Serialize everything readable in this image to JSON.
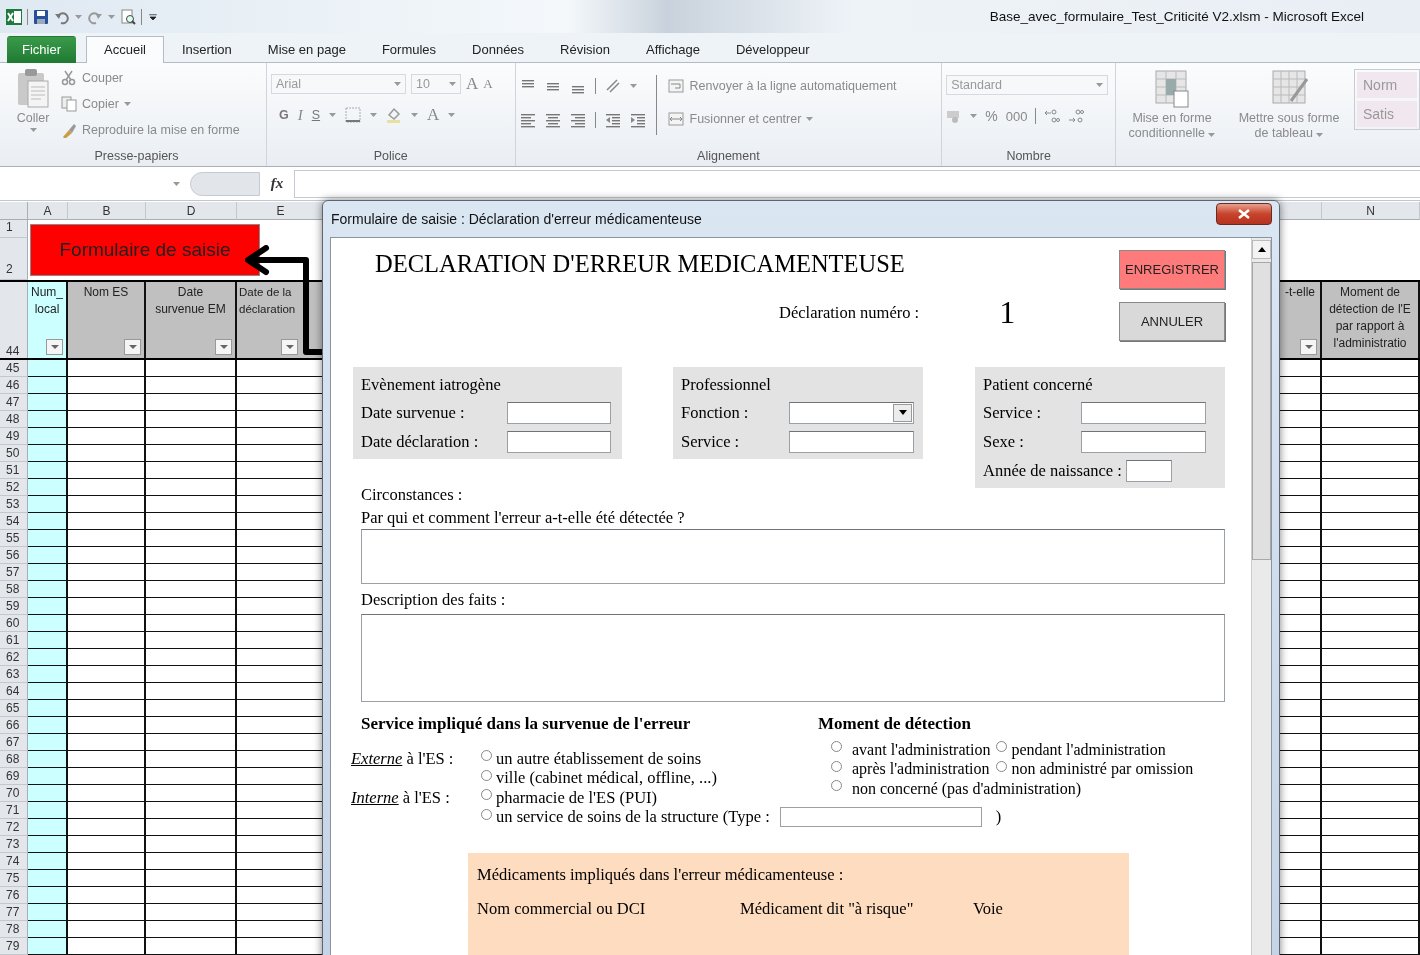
{
  "window": {
    "title": "Base_avec_formulaire_Test_Criticité V2.xlsm  -  Microsoft Excel"
  },
  "tabs": [
    {
      "label": "Fichier",
      "kind": "file",
      "selected": false
    },
    {
      "label": "Accueil",
      "kind": "tab",
      "selected": true
    },
    {
      "label": "Insertion",
      "kind": "tab",
      "selected": false
    },
    {
      "label": "Mise en page",
      "kind": "tab",
      "selected": false
    },
    {
      "label": "Formules",
      "kind": "tab",
      "selected": false
    },
    {
      "label": "Données",
      "kind": "tab",
      "selected": false
    },
    {
      "label": "Révision",
      "kind": "tab",
      "selected": false
    },
    {
      "label": "Affichage",
      "kind": "tab",
      "selected": false
    },
    {
      "label": "Développeur",
      "kind": "tab",
      "selected": false
    }
  ],
  "clipboard": {
    "paste": "Coller",
    "cut": "Couper",
    "copy": "Copier",
    "format_painter": "Reproduire la mise en forme",
    "group": "Presse-papiers"
  },
  "font": {
    "name": "Arial",
    "size": "10",
    "grow": "A",
    "shrink": "A",
    "bold": "G",
    "italic": "I",
    "underline": "S",
    "font_color": "A",
    "group": "Police"
  },
  "alignment": {
    "wrap": "Renvoyer à la ligne automatiquement",
    "merge": "Fusionner et centrer",
    "group": "Alignement"
  },
  "number": {
    "format": "Standard",
    "percent": "%",
    "thousands": "000",
    "group": "Nombre"
  },
  "styles": {
    "conditional": "Mise en forme conditionnelle",
    "table": "Mettre sous forme de tableau",
    "cell_styles": [
      "Norm",
      "Satis"
    ]
  },
  "formula_bar": {
    "function_label": "fx"
  },
  "sheet": {
    "columns": [
      {
        "letter": "A",
        "header": "Num_\nlocal",
        "color": "#ccffff",
        "highlighted": true,
        "filter": true
      },
      {
        "letter": "B",
        "header": "Nom ES",
        "color": "#c0c0c0",
        "highlighted": false,
        "filter": true
      },
      {
        "letter": "D",
        "header": "Date\nsurvenue EM",
        "color": "#c0c0c0",
        "highlighted": false,
        "filter": true
      },
      {
        "letter": "E",
        "header": "Date de la\ndéclaration",
        "color": "#c0c0c0",
        "highlighted": false,
        "filter": true
      },
      {
        "header": "-t-elle",
        "color": "#c0c0c0",
        "highlighted": false,
        "filter": true
      },
      {
        "letter": "N",
        "header": "Moment de\ndétection de l'E\npar rapport à\nl'administratio",
        "color": "#c0c0c0",
        "highlighted": false,
        "filter": false
      }
    ],
    "title_rows": [
      "1",
      "2"
    ],
    "header_row": "44",
    "rows": [
      "45",
      "46",
      "47",
      "48",
      "49",
      "50",
      "51",
      "52",
      "53",
      "54",
      "55",
      "56",
      "57",
      "58",
      "59",
      "60",
      "61",
      "62",
      "63",
      "64",
      "65",
      "66",
      "67",
      "68",
      "69",
      "70",
      "71",
      "72",
      "73",
      "74",
      "75",
      "76",
      "77",
      "78",
      "79"
    ],
    "form_button": "Formulaire de saisie"
  },
  "dialog": {
    "title": "Formulaire de saisie : Déclaration d'erreur médicamenteuse",
    "heading": "DECLARATION D'ERREUR MEDICAMENTEUSE",
    "buttons": [
      {
        "label": "ENREGISTRER",
        "kind": "primary"
      },
      {
        "label": "ANNULER",
        "kind": "secondary"
      }
    ],
    "number_label": "Déclaration numéro :",
    "number": "1",
    "panels": [
      {
        "title": "Evènement iatrogène",
        "fields": [
          {
            "label": "Date survenue :",
            "kind": "text"
          },
          {
            "label": "Date déclaration :",
            "kind": "text"
          }
        ]
      },
      {
        "title": "Professionnel",
        "fields": [
          {
            "label": "Fonction :",
            "kind": "dropdown"
          },
          {
            "label": "Service :",
            "kind": "text"
          }
        ]
      },
      {
        "title": "Patient concerné",
        "fields": [
          {
            "label": "Service :",
            "kind": "text"
          },
          {
            "label": "Sexe :",
            "kind": "text"
          },
          {
            "label": "Année de naissance :",
            "kind": "short"
          }
        ]
      }
    ],
    "circumstances_label": "Circonstances :",
    "question": "Par qui et comment l'erreur a-t-elle été détectée ?",
    "description_label": "Description des faits :",
    "service": {
      "title": "Service impliqué dans la survenue de l'erreur",
      "groups": [
        {
          "label": "Externe",
          "suffix": "à l'ES :",
          "options": [
            {
              "label": "un autre établissement de soins",
              "selected": false
            },
            {
              "label": "ville (cabinet médical, offline, ...)",
              "selected": false
            }
          ]
        },
        {
          "label": "Interne",
          "suffix": "à l'ES :",
          "options": [
            {
              "label": "pharmacie de l'ES (PUI)",
              "selected": false
            },
            {
              "label": "un service de soins de la structure (Type :",
              "selected": false,
              "field_suffix": ")"
            }
          ]
        }
      ]
    },
    "moment": {
      "title": "Moment de détection",
      "options": [
        {
          "label": "avant l'administration",
          "selected": false
        },
        {
          "label": "pendant l'administration",
          "selected": false
        },
        {
          "label": "après l'administration",
          "selected": false
        },
        {
          "label": "non administré par omission",
          "selected": false
        },
        {
          "label": "non concerné (pas d'administration)",
          "selected": false
        }
      ]
    },
    "medications": {
      "title": "Médicaments impliqués dans l'erreur médicamenteuse :",
      "columns": [
        "Nom commercial ou DCI",
        "Médicament dit \"à risque\"",
        "Voie"
      ]
    }
  }
}
